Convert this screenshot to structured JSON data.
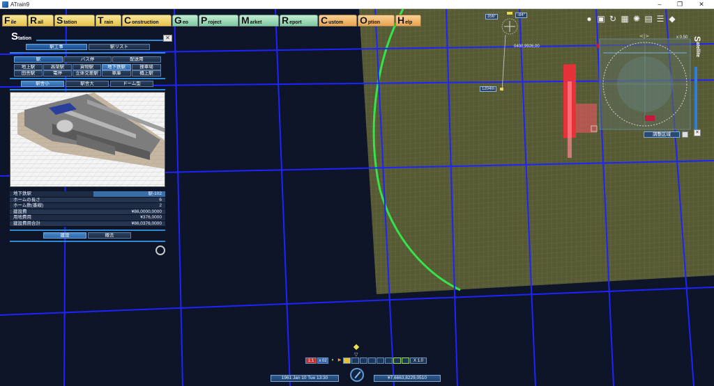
{
  "window": {
    "title": "ATrain9"
  },
  "menu": [
    {
      "cap": "F",
      "rest": "ile",
      "color": "yellow"
    },
    {
      "cap": "R",
      "rest": "ail",
      "color": "yellow"
    },
    {
      "cap": "S",
      "rest": "tation",
      "color": "yellow"
    },
    {
      "cap": "T",
      "rest": "rain",
      "color": "yellow"
    },
    {
      "cap": "C",
      "rest": "onstruction",
      "color": "yellow"
    },
    {
      "cap": "G",
      "rest": "eo",
      "color": "green"
    },
    {
      "cap": "P",
      "rest": "roject",
      "color": "green"
    },
    {
      "cap": "M",
      "rest": "arket",
      "color": "green"
    },
    {
      "cap": "R",
      "rest": "eport",
      "color": "green"
    },
    {
      "cap": "C",
      "rest": "ustom",
      "color": "orange"
    },
    {
      "cap": "O",
      "rest": "ption",
      "color": "orange"
    },
    {
      "cap": "H",
      "rest": "elp",
      "color": "orange"
    }
  ],
  "panel": {
    "title_cap": "S",
    "title_rest": "tation",
    "mode_tabs": [
      "駅工事",
      "駅リスト"
    ],
    "category_tabs": [
      "駅",
      "バス停",
      "配送用"
    ],
    "types_row1": [
      "地上駅",
      "高架駅",
      "貨物駅",
      "地下鉄駅",
      "操車場"
    ],
    "types_row2": [
      "田舎駅",
      "電停",
      "立体交差駅",
      "車庫",
      "橋上駅"
    ],
    "size_tabs": [
      "駅舎小",
      "駅舎大",
      "ドーム型"
    ],
    "info": [
      {
        "k": "地下鉄駅",
        "v": "駅-102"
      },
      {
        "k": "ホームの長さ",
        "v": "6"
      },
      {
        "k": "ホーム数(番線)",
        "v": "2"
      },
      {
        "k": "建設費",
        "v": "¥86,0000,0000"
      },
      {
        "k": "用地費用",
        "v": "¥376,0000"
      },
      {
        "k": "建設費用合計",
        "v": "¥86,0376,0000"
      }
    ],
    "actions": [
      "建設",
      "撤去"
    ]
  },
  "compass": {
    "heading_left": "356°",
    "heading_right": "-84°",
    "coords": "0400,9926,00",
    "altitude": "1204m"
  },
  "minimap": {
    "title_cap": "S",
    "title_rest": "atellite",
    "zoom": "x 0.50",
    "button": "調整区域"
  },
  "status": {
    "speed_pause": "1:1",
    "speed_mult": "x 02",
    "time_scale": "X 1.0",
    "date": "1961 Jan 10 Tue  13:30",
    "money": "¥7,6663,8229,0510"
  },
  "colors": {
    "terrain": "#565a35",
    "grid": "#1e24ff",
    "circle": "#35e34a",
    "station": "#ff2a3a"
  }
}
